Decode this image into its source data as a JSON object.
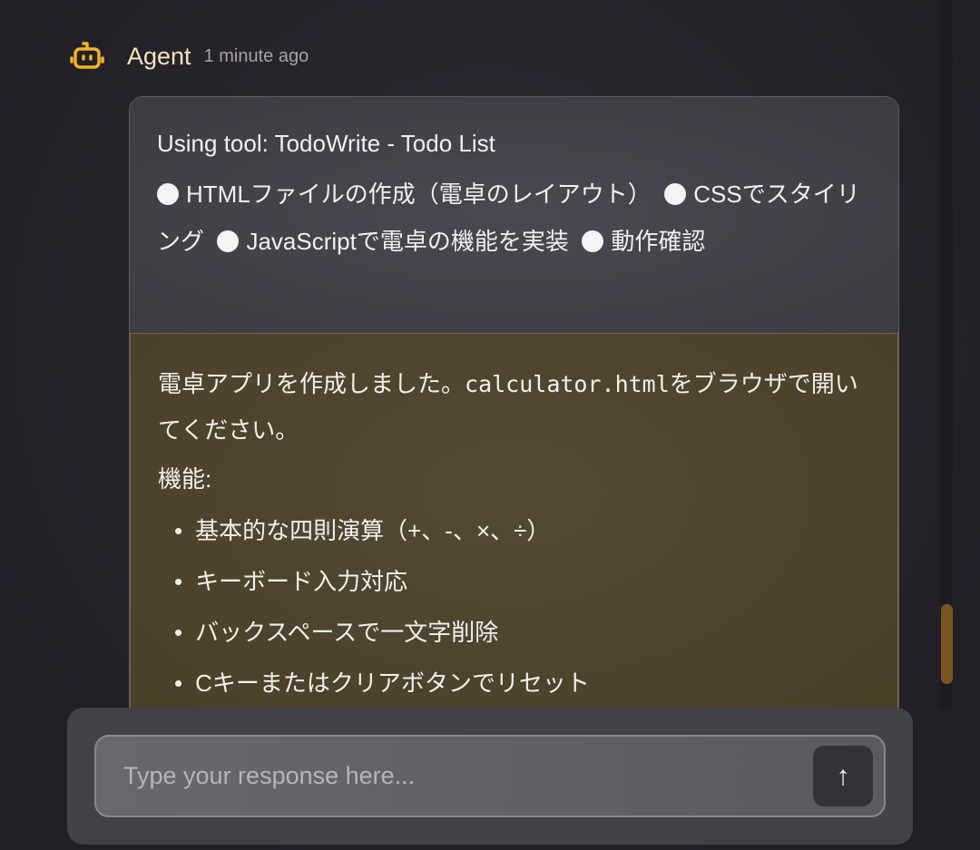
{
  "header": {
    "author": "Agent",
    "timestamp": "1 minute ago"
  },
  "tool": {
    "title": "Using tool: TodoWrite - Todo List",
    "todos": [
      "HTMLファイルの作成（電卓のレイアウト）",
      "CSSでスタイリング",
      "JavaScriptで電卓の機能を実装",
      "動作確認"
    ]
  },
  "message": {
    "intro_before": "電卓アプリを作成しました。",
    "filename": "calculator.html",
    "intro_after": "をブラウザで開いてください。",
    "features_label": "機能:",
    "features": [
      "基本的な四則演算（+、-、×、÷）",
      "キーボード入力対応",
      "バックスペースで一文字削除",
      "Cキーまたはクリアボタンでリセット"
    ]
  },
  "composer": {
    "placeholder": "Type your response here...",
    "send_icon": "↑"
  },
  "colors": {
    "accent": "#f0b429",
    "scroll_thumb": "#7a5520"
  }
}
